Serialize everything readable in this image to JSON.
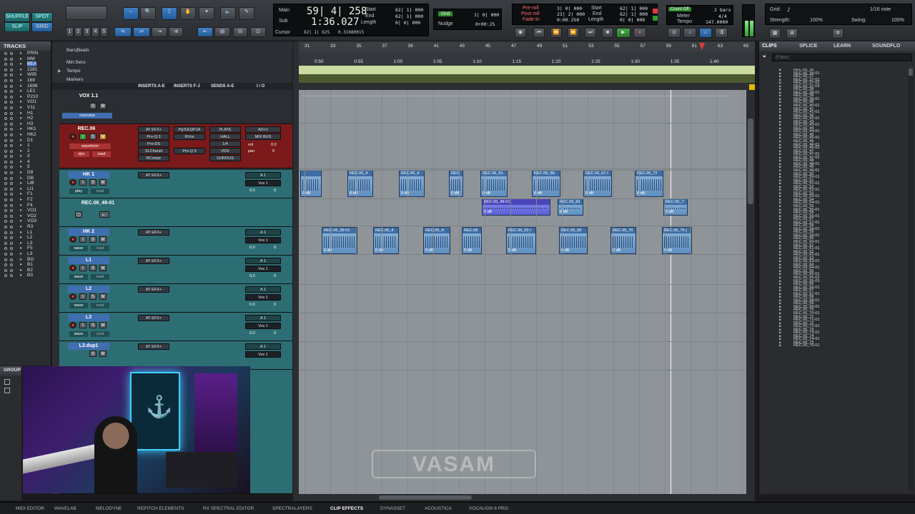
{
  "toolbar": {
    "edit_modes": [
      "SHUFFLE",
      "SPOT",
      "SLIP",
      "GRID"
    ],
    "zoom_presets": [
      "1",
      "2",
      "3",
      "4",
      "5"
    ],
    "counters": {
      "main_label": "Main",
      "main_value": "59| 4| 258",
      "sub_label": "Sub",
      "sub_value": "1:36.027",
      "cursor_label": "Cursor",
      "cursor_value": "62| 1| 625",
      "cursor_sample": "0.31680015",
      "start_label": "Start",
      "end_label": "End",
      "length_label": "Length",
      "start_value": "62| 1| 000",
      "end_value": "62| 1| 000",
      "length_value": "0| 0| 000"
    },
    "grid_label": "Grid",
    "grid_value": "1| 0| 000",
    "nudge_label": "Nudge",
    "nudge_value": "0+00:25",
    "preroll_label": "Pre-roll",
    "postroll_label": "Post-roll",
    "fadein_label": "Fade-in",
    "preroll_value": "3| 0| 000",
    "postroll_value": "23| 2| 000",
    "fadein_value": "0:00.250",
    "trans_start_label": "Start",
    "trans_end_label": "End",
    "trans_length_label": "Length",
    "trans_start": "62| 1| 000",
    "trans_end": "62| 1| 000",
    "trans_length": "0| 0| 000",
    "countoff_label": "Count Off",
    "countoff_value": "2 bars",
    "meter_label": "Meter",
    "meter_value": "4/4",
    "tempo_label": "Tempo",
    "tempo_value": "147.0000",
    "grid_note_label": "Grid:",
    "grid_note_value": "1/16 note",
    "strength_label": "Strength:",
    "strength_value": "100%",
    "swing_label": "Swing:",
    "swing_value": "100%"
  },
  "tracks_panel": {
    "title": "TRACKS",
    "items": [
      "PRIN",
      "MM",
      "BEA",
      "2281",
      "W95",
      "169",
      "1698",
      "LE1",
      "P210",
      "VO1",
      "V11",
      "H1",
      "H2",
      "H3",
      "HK1",
      "HK2",
      "D1",
      "1",
      "2",
      "3",
      "4",
      "5",
      "D8",
      "DB",
      "LIB",
      "LI1",
      "F1",
      "F2",
      "F4",
      "VO1",
      "VO2",
      "VO3",
      "R3",
      "L1",
      "L2",
      "L3",
      "F5",
      "L3",
      "BG",
      "B1",
      "B2",
      "B3"
    ]
  },
  "group_panel": {
    "title": "GROUP"
  },
  "rulers": {
    "bars_beats": "Bars|Beats",
    "min_secs": "Min:Secs",
    "tempo": "Tempo",
    "markers": "Markers",
    "bar_labels": [
      "31",
      "33",
      "35",
      "37",
      "39",
      "41",
      "43",
      "45",
      "47",
      "49",
      "51",
      "53",
      "55",
      "57",
      "59",
      "61",
      "63",
      "65"
    ],
    "time_labels": [
      "0:50",
      "0:55",
      "1:00",
      "1:05",
      "1:10",
      "1:15",
      "1:20",
      "1:25",
      "1:30",
      "1:35",
      "1:40"
    ]
  },
  "columns": {
    "inserts_ae": "INSERTS A-E",
    "inserts_fj": "INSERTS F-J",
    "sends_ae": "SENDS A-E",
    "io": "I / O"
  },
  "tracks": [
    {
      "name": "VOX 1.1",
      "view": "overview",
      "inserts": [],
      "sends": [],
      "io": ""
    },
    {
      "name": "REC.06",
      "view": "waveform",
      "mode": "dyn",
      "mode2": "read",
      "inserts": [
        "AT EFX+",
        "Pro-Q 3",
        "Pro-DS",
        "SLChanel",
        "RCompr"
      ],
      "inserts2": [
        "PgTcEQP1A",
        "RVox",
        "",
        "Pro-Q 3",
        ""
      ],
      "sends": [
        "PLATE",
        "HALL",
        "1/4",
        "VOX",
        "CHROUS"
      ],
      "io": [
        "AD+1",
        "MIX BUS"
      ],
      "vol_label": "vol",
      "vol": "0.0",
      "pan_label": "pan",
      "pan": "0"
    },
    {
      "name": "HK 1",
      "view": "play",
      "mode": "read",
      "inserts": [
        "AT EFX+"
      ],
      "io": [
        "A 1",
        "Vox 1"
      ],
      "vol": "0.0",
      "pan": "0"
    },
    {
      "name": "REC.06_49-01"
    },
    {
      "name": "HK 2",
      "view": "wave",
      "mode": "read",
      "inserts": [
        "AT EFX+"
      ],
      "io": [
        "A 1",
        "Vox 1"
      ],
      "vol": "0.0",
      "pan": "0"
    },
    {
      "name": "L1",
      "view": "wave",
      "mode": "read",
      "inserts": [
        "AT EFX+"
      ],
      "io": [
        "A 1",
        "Vox 1"
      ],
      "vol": "0.0",
      "pan": "0"
    },
    {
      "name": "L2",
      "view": "wave",
      "mode": "read",
      "inserts": [
        "AT EFX+"
      ],
      "io": [
        "A 1",
        "Vox 1"
      ],
      "vol": "0.0",
      "pan": "0"
    },
    {
      "name": "L3",
      "view": "wave",
      "mode": "read",
      "inserts": [
        "AT EFX+"
      ],
      "io": [
        "A 1",
        "Vox 1"
      ],
      "vol": "0.0",
      "pan": "0"
    },
    {
      "name": "L3.dup1",
      "inserts": [
        "AT EFX+"
      ],
      "io": [
        "A 1",
        "Vox 1"
      ]
    }
  ],
  "clips": {
    "lane_hk1": [
      {
        "name": "",
        "db": "0 dB"
      },
      {
        "name": "REC.06_4",
        "db": "0 dB"
      },
      {
        "name": "REC.06_4",
        "db": "0 dB"
      },
      {
        "name": "REC",
        "db": "0 dB"
      },
      {
        "name": "REC.06_51-",
        "db": "0 dB"
      },
      {
        "name": "REC.06_56-",
        "db": "0 dB"
      },
      {
        "name": "REC.06_67-I",
        "db": "0 dB"
      },
      {
        "name": "REC.06_72",
        "db": "0 dB"
      }
    ],
    "lane_alt": [
      {
        "name": "REC.06_49-01",
        "db": "0 dB"
      },
      {
        "name": "REC.06_63",
        "db": "0 dB"
      },
      {
        "name": "REC.06_7:",
        "db": "0 dB"
      }
    ],
    "lane_hk2": [
      {
        "name": "REC.06_39-01",
        "db": "0 dB"
      },
      {
        "name": "REC.06_4",
        "db": "0 dB"
      },
      {
        "name": "REC.06_4:",
        "db": "0 dB"
      },
      {
        "name": "REC.06",
        "db": "0 dB"
      },
      {
        "name": "REC.06_52-I",
        "db": "0 dB"
      },
      {
        "name": "REC.06_60",
        "db": "0 dB"
      },
      {
        "name": "REC.06_70",
        "db": "0 dB"
      },
      {
        "name": "REC.06_75-(",
        "db": "0 dB"
      }
    ]
  },
  "clips_panel": {
    "tabs": [
      "CLIPS",
      "SPLICE",
      "LEARN",
      "SOUNDFLO"
    ],
    "filter_placeholder": "(Filter)",
    "items": [
      "REC.06_36",
      "REC.06_36-01",
      "REC.06_37",
      "REC.06_37-01",
      "REC.06_37-02",
      "REC.06_37-03",
      "REC.06_38",
      "REC.06_38-01",
      "REC.06_39",
      "REC.06_39-01",
      "REC.06_40",
      "REC.06_40-01",
      "REC.06_41",
      "REC.06_41-01",
      "REC.06_42",
      "REC.06_42-01",
      "REC.06_43",
      "REC.06_43-01",
      "REC.06_44",
      "REC.06_44-01",
      "REC.06_45",
      "REC.06_45-01",
      "REC.06_46",
      "REC.06_46-01",
      "REC.06_46-02",
      "REC.06_47",
      "REC.06_47-01",
      "REC.06_47-02",
      "REC.06_48",
      "REC.06_48-01",
      "REC.06_49",
      "REC.06_49-01",
      "REC.06_50",
      "REC.06_50-01",
      "REC.06_51",
      "REC.06_51-01",
      "REC.06_52",
      "REC.06_52-01",
      "REC.06_53",
      "REC.06_53-01",
      "REC.06_54",
      "REC.06_54-01",
      "REC.06_55",
      "REC.06_55-01",
      "REC.06_56",
      "REC.06_56-01",
      "REC.06_57",
      "REC.06_57-01",
      "REC.06_58",
      "REC.06_58-01",
      "REC.06_59",
      "REC.06_59-01",
      "REC.06_60",
      "REC.06_60-01",
      "REC.06_61",
      "REC.06_61-01",
      "REC.06_62",
      "REC.06_62-01",
      "REC.06_63",
      "REC.06_63-01",
      "REC.06_64",
      "REC.06_64-01",
      "REC.06_65",
      "REC.06_65-01",
      "REC.06_65-02",
      "REC.06_65-03",
      "REC.06_66",
      "REC.06_66-01",
      "REC.06_67",
      "REC.06_67-01",
      "REC.06_68",
      "REC.06_68-01",
      "REC.06_69",
      "REC.06_69-01",
      "REC.06_70",
      "REC.06_70-01",
      "REC.06_71",
      "REC.06_71-01",
      "REC.06_72",
      "REC.06_72-01",
      "REC.06_73",
      "REC.06_73-01",
      "REC.06_74",
      "REC.06_74-01",
      "REC.06_75",
      "REC.06_75-01"
    ]
  },
  "bottom_tabs": [
    "MIDI EDITOR",
    "WAVELAB",
    "MELODYNE",
    "REPITCH ELEMENTS",
    "RX SPECTRAL EDITOR",
    "SPECTRALAYERS",
    "CLIP EFFECTS",
    "DYNASSET",
    "ACOUSTICA",
    "VOCALIGN 6 PRO"
  ],
  "active_bottom_tab": "CLIP EFFECTS",
  "colors": {
    "accent": "#3f6fb0",
    "selected_track": "#8d1b1b",
    "clip": "#6f9ccc",
    "tempo_lane": "#c9dda0"
  }
}
